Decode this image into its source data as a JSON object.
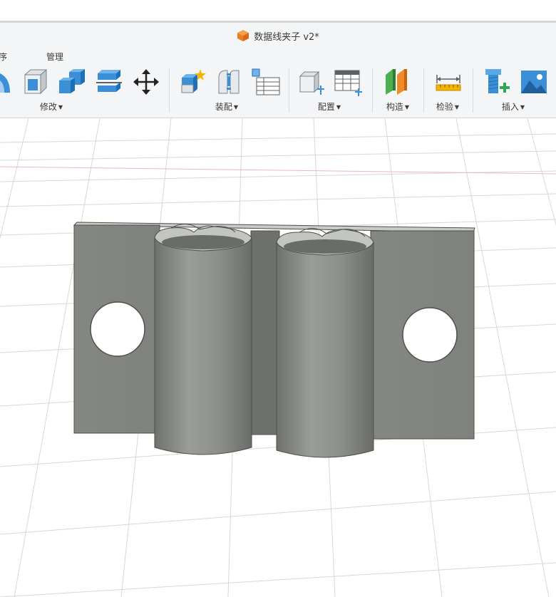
{
  "document": {
    "title": "数据线夹子 v2*",
    "icon": "orange-box-icon",
    "accent": "#f08b2a"
  },
  "tabs": [
    {
      "label": "序"
    },
    {
      "label": "管理"
    }
  ],
  "toolbar": {
    "groups": [
      {
        "label": "修改",
        "tools": [
          "fillet-icon",
          "shell-icon",
          "combine-icon",
          "split-body-icon",
          "move-icon"
        ]
      },
      {
        "label": "装配",
        "tools": [
          "new-component-icon",
          "joint-icon",
          "component-table-icon"
        ]
      },
      {
        "label": "配置",
        "tools": [
          "configure-icon",
          "configuration-table-icon"
        ]
      },
      {
        "label": "构造",
        "tools": [
          "midplane-icon"
        ]
      },
      {
        "label": "检验",
        "tools": [
          "measure-icon"
        ]
      },
      {
        "label": "插入",
        "tools": [
          "insert-bolt-icon",
          "insert-image-icon"
        ]
      }
    ]
  },
  "viewport": {
    "model": "cable-clip-model",
    "grid_color": "#d5d5d5",
    "axis_color": "#e8a0a0",
    "body_color": "#8a8c88"
  }
}
